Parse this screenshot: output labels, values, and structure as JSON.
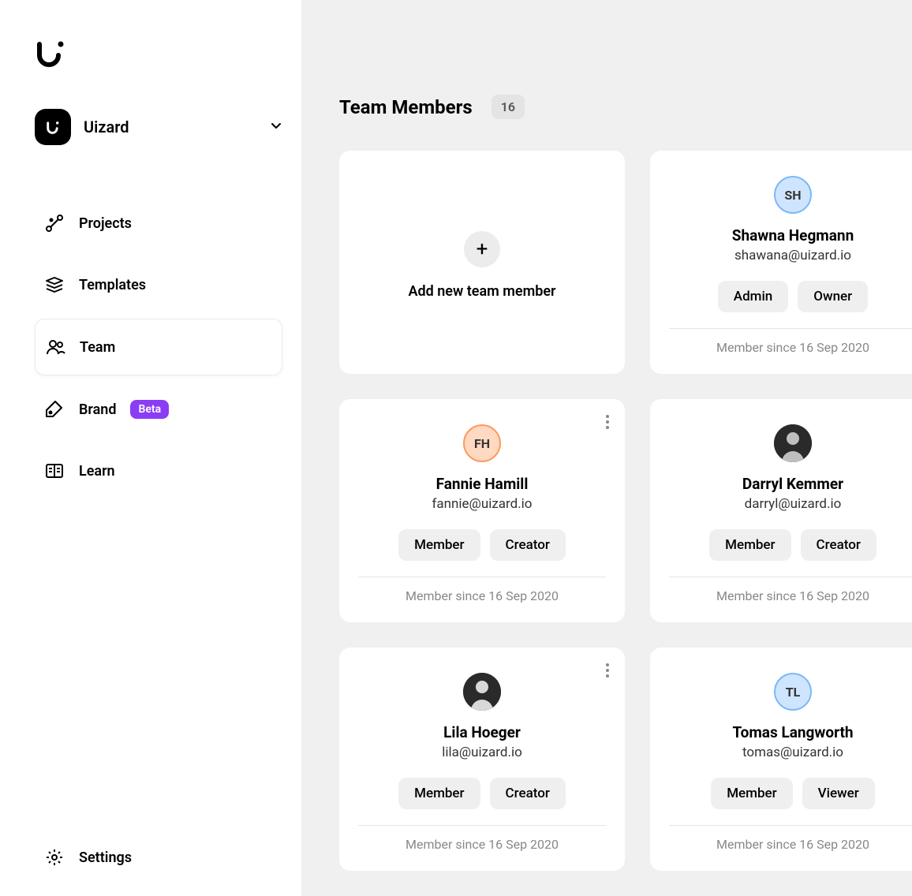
{
  "workspace": {
    "name": "Uizard"
  },
  "nav": {
    "projects": "Projects",
    "templates": "Templates",
    "team": "Team",
    "brand": "Brand",
    "brand_badge": "Beta",
    "learn": "Learn",
    "settings": "Settings"
  },
  "page": {
    "title": "Team Members",
    "count": "16",
    "add_label": "Add new team member"
  },
  "members": [
    {
      "initials": "SH",
      "avatar_class": "sh",
      "name": "Shawna Hegmann",
      "email": "shawana@uizard.io",
      "roles": [
        "Admin",
        "Owner"
      ],
      "since": "Member since 16 Sep 2020"
    },
    {
      "initials": "FH",
      "avatar_class": "fh",
      "name": "Fannie Hamill",
      "email": "fannie@uizard.io",
      "roles": [
        "Member",
        "Creator"
      ],
      "since": "Member since 16 Sep 2020"
    },
    {
      "initials": "",
      "avatar_class": "img",
      "name": "Darryl Kemmer",
      "email": "darryl@uizard.io",
      "roles": [
        "Member",
        "Creator"
      ],
      "since": "Member since 16 Sep 2020"
    },
    {
      "initials": "",
      "avatar_class": "img",
      "name": "Lila Hoeger",
      "email": "lila@uizard.io",
      "roles": [
        "Member",
        "Creator"
      ],
      "since": "Member since 16 Sep 2020"
    },
    {
      "initials": "TL",
      "avatar_class": "tl",
      "name": "Tomas Langworth",
      "email": "tomas@uizard.io",
      "roles": [
        "Member",
        "Viewer"
      ],
      "since": "Member since 16 Sep 2020"
    }
  ]
}
